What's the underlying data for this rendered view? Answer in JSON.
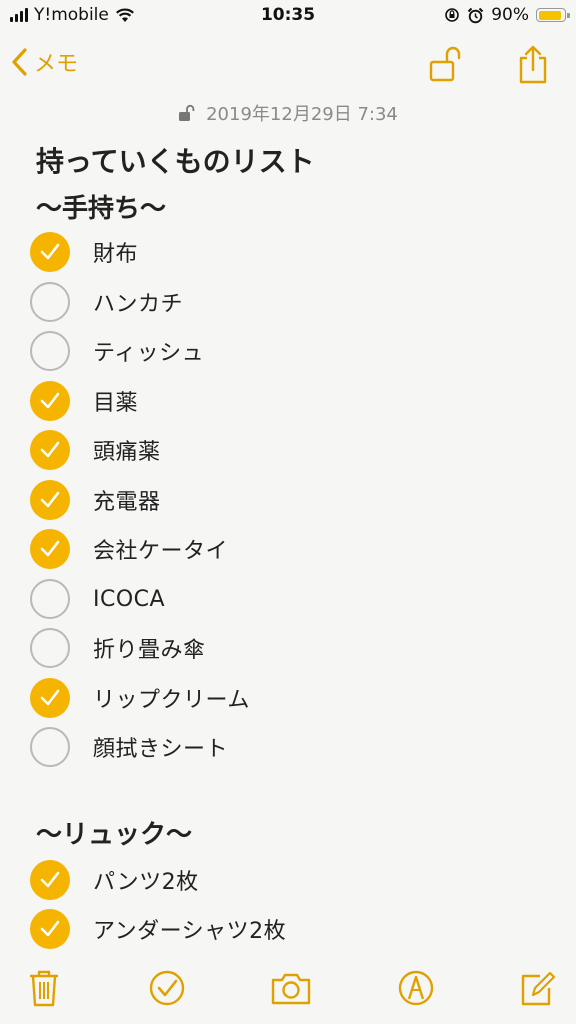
{
  "status": {
    "carrier": "Y!mobile",
    "time": "10:35",
    "battery_percent": "90%",
    "battery_level": 0.9
  },
  "nav": {
    "back_label": "メモ"
  },
  "note": {
    "date": "2019年12月29日 7:34",
    "title": "持っていくものリスト",
    "sections": [
      {
        "heading": "〜手持ち〜",
        "items": [
          {
            "label": "財布",
            "checked": true
          },
          {
            "label": "ハンカチ",
            "checked": false
          },
          {
            "label": "ティッシュ",
            "checked": false
          },
          {
            "label": "目薬",
            "checked": true
          },
          {
            "label": "頭痛薬",
            "checked": true
          },
          {
            "label": "充電器",
            "checked": true
          },
          {
            "label": "会社ケータイ",
            "checked": true
          },
          {
            "label": "ICOCA",
            "checked": false
          },
          {
            "label": "折り畳み傘",
            "checked": false
          },
          {
            "label": "リップクリーム",
            "checked": true
          },
          {
            "label": "顔拭きシート",
            "checked": false
          }
        ]
      },
      {
        "heading": "〜リュック〜",
        "items": [
          {
            "label": "パンツ2枚",
            "checked": true
          },
          {
            "label": "アンダーシャツ2枚",
            "checked": true
          }
        ]
      }
    ]
  },
  "colors": {
    "accent": "#e0a100",
    "check_fill": "#f5b400",
    "unchecked_border": "#b9b9b9",
    "background": "#f6f6f4"
  },
  "icons": {
    "nav": [
      "back-chevron-icon",
      "unlock-icon",
      "share-icon"
    ],
    "toolbar": [
      "trash-icon",
      "checklist-icon",
      "camera-icon",
      "markup-pen-icon",
      "compose-icon"
    ]
  }
}
